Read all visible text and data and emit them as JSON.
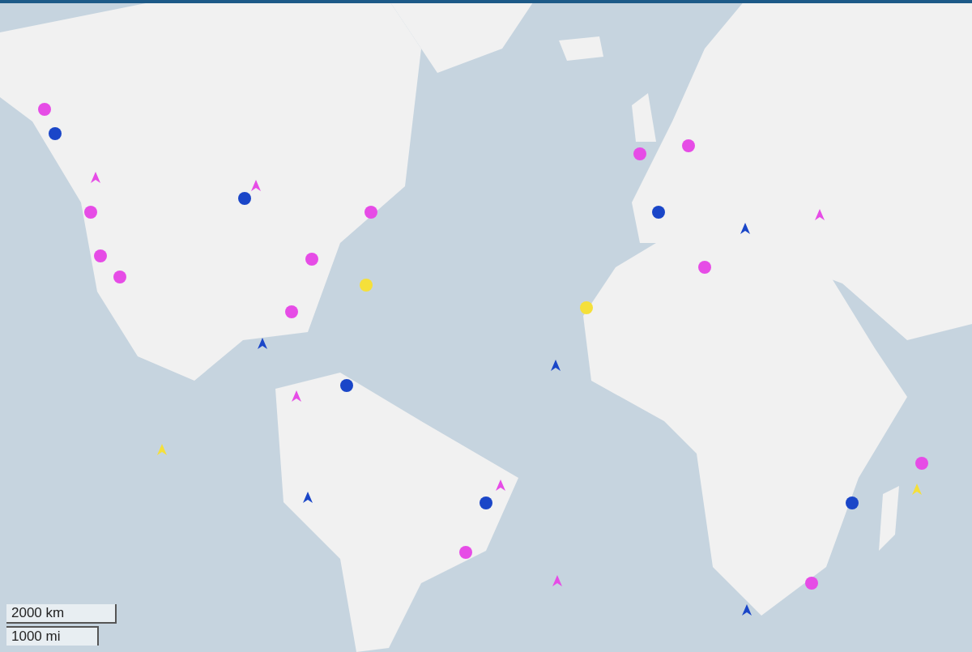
{
  "map": {
    "kind": "picture",
    "markers": [
      {
        "kind": "dot",
        "color": "#e64ce6"
      },
      {
        "kind": "dot",
        "color": "#1a46c8"
      },
      {
        "kind": "ship",
        "color": "#e64ce6"
      },
      {
        "kind": "dot",
        "color": "#e64ce6"
      },
      {
        "kind": "dot",
        "color": "#e64ce6"
      },
      {
        "kind": "dot",
        "color": "#1a46c8"
      },
      {
        "kind": "dot",
        "color": "#e64ce6"
      },
      {
        "kind": "dot",
        "color": "#e64ce6"
      },
      {
        "kind": "dot",
        "color": "#f5e03a"
      },
      {
        "kind": "ship",
        "color": "#e64ce6"
      },
      {
        "kind": "dot",
        "color": "#e64ce6"
      },
      {
        "kind": "ship",
        "color": "#1a46c8"
      },
      {
        "kind": "dot",
        "color": "#e64ce6"
      },
      {
        "kind": "dot",
        "color": "#1a46c8"
      },
      {
        "kind": "ship",
        "color": "#e64ce6"
      },
      {
        "kind": "ship",
        "color": "#f5e03a"
      },
      {
        "kind": "ship",
        "color": "#1a46c8"
      },
      {
        "kind": "ship",
        "color": "#e64ce6"
      },
      {
        "kind": "dot",
        "color": "#1a46c8"
      },
      {
        "kind": "dot",
        "color": "#e64ce6"
      },
      {
        "kind": "ship",
        "color": "#e64ce6"
      },
      {
        "kind": "dot",
        "color": "#f5e03a"
      },
      {
        "kind": "ship",
        "color": "#1a46c8"
      },
      {
        "kind": "dot",
        "color": "#e64ce6"
      },
      {
        "kind": "dot",
        "color": "#1a46c8"
      },
      {
        "kind": "dot",
        "color": "#e64ce6"
      },
      {
        "kind": "ship",
        "color": "#1a46c8"
      },
      {
        "kind": "dot",
        "color": "#e64ce6"
      },
      {
        "kind": "ship",
        "color": "#f5e03a"
      },
      {
        "kind": "ship",
        "color": "#e64ce6"
      },
      {
        "kind": "dot",
        "color": "#1a46c8"
      },
      {
        "kind": "dot",
        "color": "#e64ce6"
      },
      {
        "kind": "ship",
        "color": "#1a46c8"
      },
      {
        "kind": "dot",
        "color": "#e64ce6"
      }
    ]
  },
  "scale": {
    "metric": "2000 km",
    "imperial": "1000 mi"
  }
}
